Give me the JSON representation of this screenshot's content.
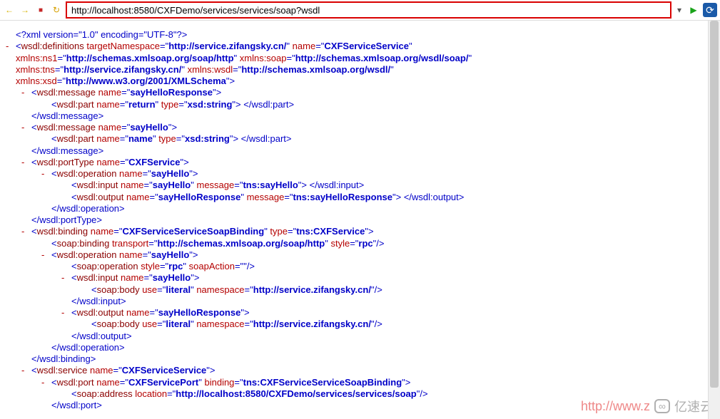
{
  "toolbar": {
    "url": "http://localhost:8580/CXFDemo/services/services/soap?wsdl",
    "back_icon": "←",
    "fwd_icon": "→",
    "stop_icon": "■",
    "refresh_icon": "↻",
    "dropdown_icon": "▾",
    "go_icon": "▶",
    "globe_icon": "⟳"
  },
  "xml": {
    "decl": "<?xml version=\"1.0\" encoding=\"UTF-8\"?>",
    "defs_targetNs": "http://service.zifangsky.cn/",
    "defs_name": "CXFServiceService",
    "ns1": "http://schemas.xmlsoap.org/soap/http",
    "soapNs": "http://schemas.xmlsoap.org/wsdl/soap/",
    "tnsNs": "http://service.zifangsky.cn/",
    "wsdlNs": "http://schemas.xmlsoap.org/wsdl/",
    "xsdNs": "http://www.w3.org/2001/XMLSchema",
    "msg1_name": "sayHelloResponse",
    "msg1_part_name": "return",
    "msg1_part_type": "xsd:string",
    "msg2_name": "sayHello",
    "msg2_part_name": "name",
    "msg2_part_type": "xsd:string",
    "porttype_name": "CXFService",
    "op_name": "sayHello",
    "input_name": "sayHello",
    "input_msg": "tns:sayHello",
    "output_name": "sayHelloResponse",
    "output_msg": "tns:sayHelloResponse",
    "binding_name": "CXFServiceServiceSoapBinding",
    "binding_type": "tns:CXFService",
    "binding_transport": "http://schemas.xmlsoap.org/soap/http",
    "binding_style": "rpc",
    "op2_name": "sayHello",
    "soapop_style": "rpc",
    "soapop_action": "",
    "b_in_name": "sayHello",
    "body_use": "literal",
    "body_ns": "http://service.zifangsky.cn/",
    "b_out_name": "sayHelloResponse",
    "service_name": "CXFServiceService",
    "port_name": "CXFServicePort",
    "port_binding": "tns:CXFServiceServiceSoapBinding",
    "address_loc": "http://localhost:8580/CXFDemo/services/services/soap",
    "close_msg": "</wsdl:message>",
    "close_op": "</wsdl:operation>",
    "close_pt": "</wsdl:portType>",
    "close_in": "</wsdl:input>",
    "close_out": "</wsdl:output>",
    "close_bind": "</wsdl:binding>",
    "close_port": "</wsdl:port>",
    "close_partend": "</wsdl:part>",
    "close_inend": "</wsdl:input>",
    "close_outend": "</wsdl:output>"
  },
  "watermark": {
    "url": "http://www.z",
    "brand": "亿速云"
  }
}
